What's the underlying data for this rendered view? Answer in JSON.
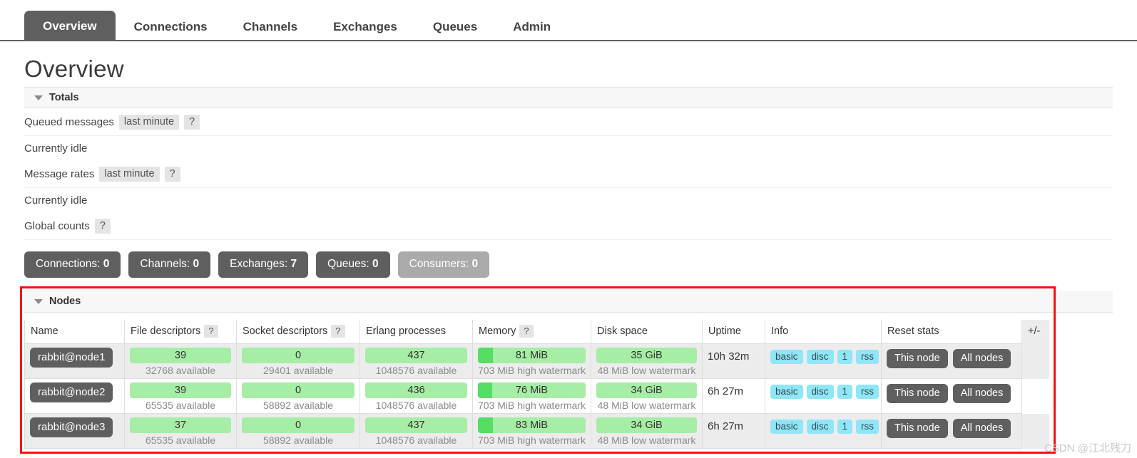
{
  "nav": {
    "tabs": [
      {
        "label": "Overview",
        "active": true
      },
      {
        "label": "Connections",
        "active": false
      },
      {
        "label": "Channels",
        "active": false
      },
      {
        "label": "Exchanges",
        "active": false
      },
      {
        "label": "Queues",
        "active": false
      },
      {
        "label": "Admin",
        "active": false
      }
    ]
  },
  "page": {
    "title": "Overview"
  },
  "totals": {
    "section_label": "Totals",
    "queued_messages_label": "Queued messages",
    "queued_messages_period": "last minute",
    "queued_messages_help": "?",
    "queued_messages_status": "Currently idle",
    "message_rates_label": "Message rates",
    "message_rates_period": "last minute",
    "message_rates_help": "?",
    "message_rates_status": "Currently idle",
    "global_counts_label": "Global counts",
    "global_counts_help": "?",
    "counts": [
      {
        "label": "Connections:",
        "value": "0",
        "disabled": false
      },
      {
        "label": "Channels:",
        "value": "0",
        "disabled": false
      },
      {
        "label": "Exchanges:",
        "value": "7",
        "disabled": false
      },
      {
        "label": "Queues:",
        "value": "0",
        "disabled": false
      },
      {
        "label": "Consumers:",
        "value": "0",
        "disabled": true
      }
    ]
  },
  "nodes": {
    "section_label": "Nodes",
    "columns": {
      "name": "Name",
      "file_descriptors": "File descriptors",
      "file_descriptors_help": "?",
      "socket_descriptors": "Socket descriptors",
      "socket_descriptors_help": "?",
      "erlang_processes": "Erlang processes",
      "memory": "Memory",
      "memory_help": "?",
      "disk_space": "Disk space",
      "uptime": "Uptime",
      "info": "Info",
      "reset_stats": "Reset stats",
      "plusminus": "+/-"
    },
    "reset_buttons": {
      "this_node": "This node",
      "all_nodes": "All nodes"
    },
    "rows": [
      {
        "name": "rabbit@node1",
        "file_descriptors": {
          "value": "39",
          "sub": "32768 available",
          "pct": 100
        },
        "socket_descriptors": {
          "value": "0",
          "sub": "29401 available",
          "pct": 100
        },
        "erlang_processes": {
          "value": "437",
          "sub": "1048576 available",
          "pct": 100
        },
        "memory": {
          "value": "81 MiB",
          "sub": "703 MiB high watermark",
          "pct": 14
        },
        "disk_space": {
          "value": "35 GiB",
          "sub": "48 MiB low watermark",
          "pct": 100
        },
        "uptime": "10h 32m",
        "info_tags": [
          "basic",
          "disc",
          "1",
          "rss"
        ]
      },
      {
        "name": "rabbit@node2",
        "file_descriptors": {
          "value": "39",
          "sub": "65535 available",
          "pct": 100
        },
        "socket_descriptors": {
          "value": "0",
          "sub": "58892 available",
          "pct": 100
        },
        "erlang_processes": {
          "value": "436",
          "sub": "1048576 available",
          "pct": 100
        },
        "memory": {
          "value": "76 MiB",
          "sub": "703 MiB high watermark",
          "pct": 13
        },
        "disk_space": {
          "value": "34 GiB",
          "sub": "48 MiB low watermark",
          "pct": 100
        },
        "uptime": "6h 27m",
        "info_tags": [
          "basic",
          "disc",
          "1",
          "rss"
        ]
      },
      {
        "name": "rabbit@node3",
        "file_descriptors": {
          "value": "37",
          "sub": "65535 available",
          "pct": 100
        },
        "socket_descriptors": {
          "value": "0",
          "sub": "58892 available",
          "pct": 100
        },
        "erlang_processes": {
          "value": "437",
          "sub": "1048576 available",
          "pct": 100
        },
        "memory": {
          "value": "83 MiB",
          "sub": "703 MiB high watermark",
          "pct": 14
        },
        "disk_space": {
          "value": "34 GiB",
          "sub": "48 MiB low watermark",
          "pct": 100
        },
        "uptime": "6h 27m",
        "info_tags": [
          "basic",
          "disc",
          "1",
          "rss"
        ]
      }
    ]
  },
  "watermark": {
    "text": "CSDN @江北残刀"
  },
  "colors": {
    "tab_active_bg": "#605f5f",
    "bar_light": "#a6eda6",
    "bar_dark": "#55dd64",
    "tag_bg": "#8fe6f7",
    "button_bg": "#605f5f",
    "button_disabled_bg": "#aaaaaa",
    "annotation_red": "#fb0d0d"
  }
}
